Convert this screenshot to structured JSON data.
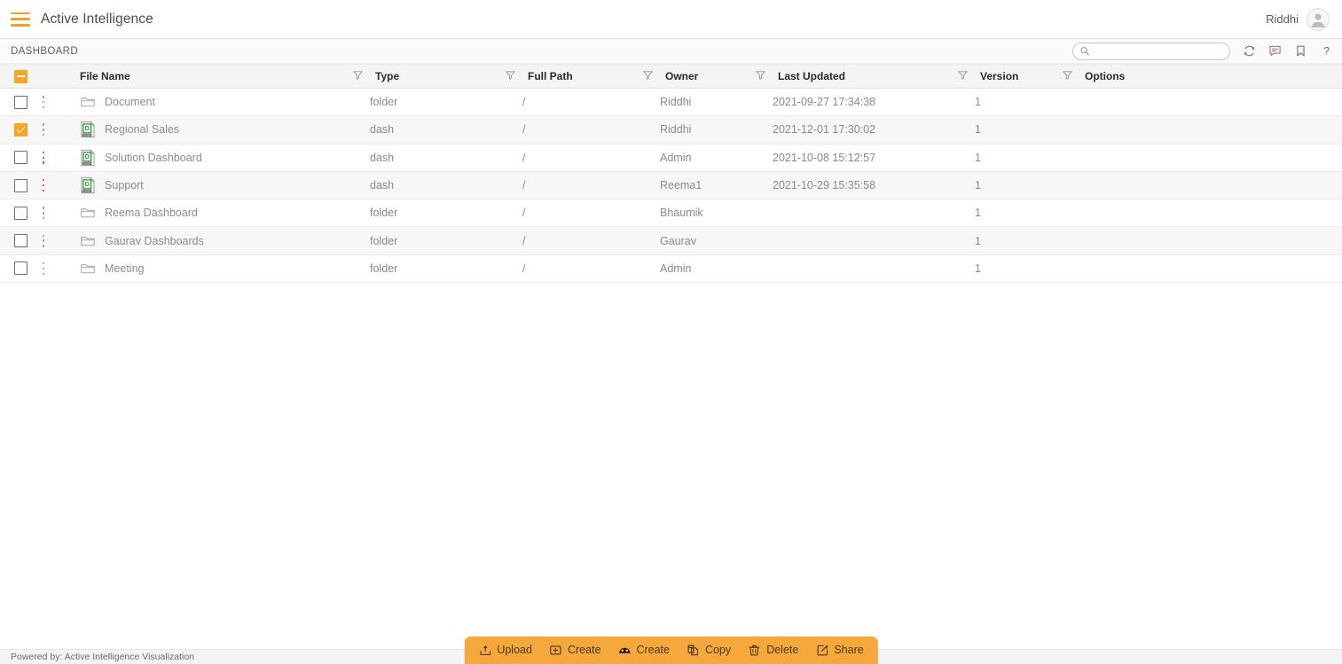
{
  "header": {
    "menu_icon": "hamburger-icon",
    "title": "Active Intelligence",
    "username": "Riddhi",
    "avatar_icon": "user-avatar-icon"
  },
  "breadcrumb": {
    "label": "DASHBOARD",
    "search_placeholder": "",
    "search_value": "",
    "tools": [
      {
        "name": "refresh-icon",
        "title": "Refresh"
      },
      {
        "name": "comment-icon",
        "title": "Comments"
      },
      {
        "name": "bookmark-icon",
        "title": "Bookmark"
      },
      {
        "name": "help-icon",
        "title": "Help"
      }
    ]
  },
  "table": {
    "select_all_state": "indeterminate",
    "columns": [
      {
        "key": "file_name",
        "label": "File Name",
        "filter": true
      },
      {
        "key": "type",
        "label": "Type",
        "filter": true
      },
      {
        "key": "full_path",
        "label": "Full Path",
        "filter": true
      },
      {
        "key": "owner",
        "label": "Owner",
        "filter": true
      },
      {
        "key": "last_updated",
        "label": "Last Updated",
        "filter": true
      },
      {
        "key": "version",
        "label": "Version",
        "filter": true
      },
      {
        "key": "options",
        "label": "Options",
        "filter": false
      }
    ],
    "rows": [
      {
        "selected": false,
        "kebab_alert": false,
        "icon": "folder-icon",
        "file_name": "Document",
        "type": "folder",
        "full_path": "/",
        "owner": "Riddhi",
        "last_updated": "2021-09-27 17:34:38",
        "version": "1",
        "options": ""
      },
      {
        "selected": true,
        "kebab_alert": false,
        "icon": "dash-file-icon",
        "file_name": "Regional Sales",
        "type": "dash",
        "full_path": "/",
        "owner": "Riddhi",
        "last_updated": "2021-12-01 17:30:02",
        "version": "1",
        "options": ""
      },
      {
        "selected": false,
        "kebab_alert": true,
        "icon": "dash-file-icon",
        "file_name": "Solution Dashboard",
        "type": "dash",
        "full_path": "/",
        "owner": "Admin",
        "last_updated": "2021-10-08 15:12:57",
        "version": "1",
        "options": ""
      },
      {
        "selected": false,
        "kebab_alert": true,
        "icon": "dash-file-icon",
        "file_name": "Support",
        "type": "dash",
        "full_path": "/",
        "owner": "Reema1",
        "last_updated": "2021-10-29 15:35:58",
        "version": "1",
        "options": ""
      },
      {
        "selected": false,
        "kebab_alert": false,
        "icon": "folder-icon",
        "file_name": "Reema Dashboard",
        "type": "folder",
        "full_path": "/",
        "owner": "Bhaumik",
        "last_updated": "",
        "version": "1",
        "options": ""
      },
      {
        "selected": false,
        "kebab_alert": false,
        "icon": "folder-icon",
        "file_name": "Gaurav Dashboards",
        "type": "folder",
        "full_path": "/",
        "owner": "Gaurav",
        "last_updated": "",
        "version": "1",
        "options": ""
      },
      {
        "selected": false,
        "kebab_alert": false,
        "icon": "folder-icon",
        "file_name": "Meeting",
        "type": "folder",
        "full_path": "/",
        "owner": "Admin",
        "last_updated": "",
        "version": "1",
        "options": ""
      }
    ]
  },
  "actionbar": {
    "items": [
      {
        "icon": "upload-icon",
        "label": "Upload"
      },
      {
        "icon": "add-folder-icon",
        "label": "Create"
      },
      {
        "icon": "dashboard-icon",
        "label": "Create"
      },
      {
        "icon": "copy-icon",
        "label": "Copy"
      },
      {
        "icon": "trash-icon",
        "label": "Delete"
      },
      {
        "icon": "share-icon",
        "label": "Share"
      }
    ]
  },
  "footer": {
    "text": "Powered by: Active Intelligence Visualization"
  },
  "colors": {
    "accent": "#f5a623",
    "actionbar": "#f5a93c",
    "header_bg": "#f4f4f4",
    "alert": "#e03030",
    "dash_green": "#2f9e41"
  }
}
